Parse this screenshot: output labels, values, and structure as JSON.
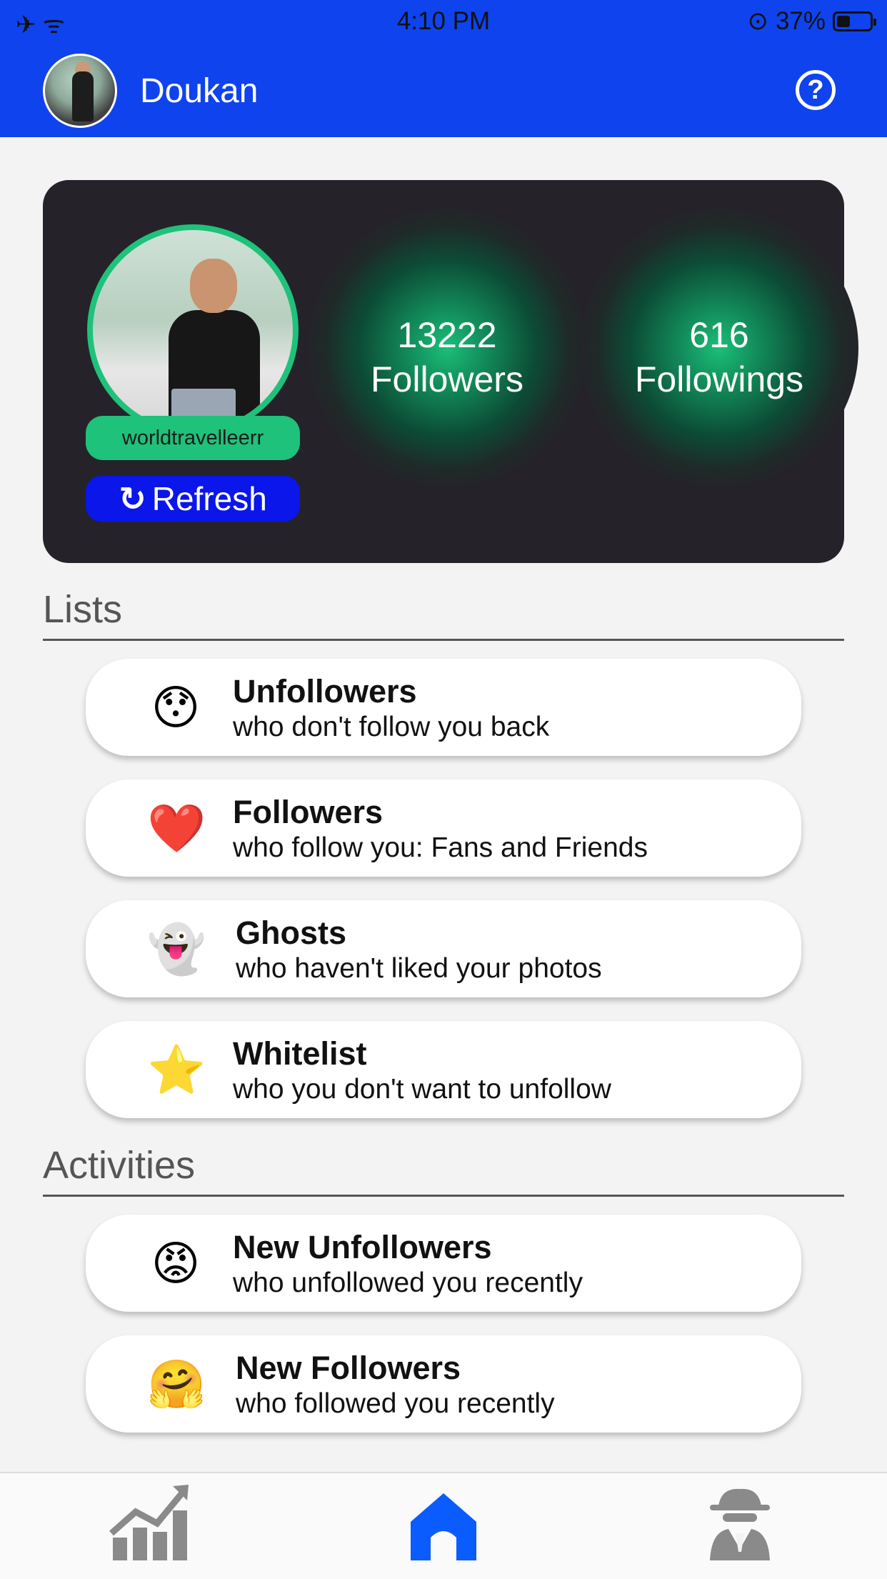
{
  "status_bar": {
    "time": "4:10 PM",
    "left_icons": "✈ ᯤ",
    "lock_icon": "⊙",
    "battery_percent": "37%",
    "battery_level": 0.37
  },
  "header": {
    "name": "Doukan",
    "help_label": "?"
  },
  "profile": {
    "username": "worldtravelleerr",
    "refresh_label": "Refresh",
    "refresh_icon": "↻",
    "followers_count": "13222",
    "followers_label": "Followers",
    "followings_count": "616",
    "followings_label": "Followings"
  },
  "lists": {
    "title": "Lists",
    "items": [
      {
        "emoji": "😯",
        "title": "Unfollowers",
        "subtitle": "who don't follow you back"
      },
      {
        "emoji": "❤️",
        "title": "Followers",
        "subtitle": "who follow you: Fans and Friends"
      },
      {
        "emoji": "👻",
        "title": "Ghosts",
        "subtitle": "who haven't liked your photos"
      },
      {
        "emoji": "⭐",
        "title": "Whitelist",
        "subtitle": "who you don't want to unfollow"
      }
    ]
  },
  "activities": {
    "title": "Activities",
    "items": [
      {
        "emoji": "😡",
        "title": "New Unfollowers",
        "subtitle": "who unfollowed you recently"
      },
      {
        "emoji": "🤗",
        "title": "New Followers",
        "subtitle": "who followed you recently"
      }
    ]
  },
  "colors": {
    "header_blue": "#0f43ee",
    "accent_green": "#1ec27a",
    "refresh_blue": "#0a16ea",
    "card_dark": "#25222a",
    "tab_active": "#0a5cff",
    "tab_inactive": "#8a8a8a"
  },
  "tabs": [
    {
      "icon": "stats-chart-icon",
      "active": false
    },
    {
      "icon": "home-icon",
      "active": true
    },
    {
      "icon": "spy-icon",
      "active": false
    }
  ]
}
